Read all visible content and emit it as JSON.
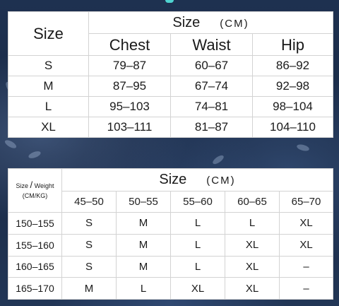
{
  "chest_table": {
    "size_header": "Size",
    "title": "Size",
    "unit": "(CM)",
    "columns": [
      "Chest",
      "Waist",
      "Hip"
    ],
    "rows": [
      {
        "size": "S",
        "chest": "79–87",
        "waist": "60–67",
        "hip": "86–92"
      },
      {
        "size": "M",
        "chest": "87–95",
        "waist": "67–74",
        "hip": "92–98"
      },
      {
        "size": "L",
        "chest": "95–103",
        "waist": "74–81",
        "hip": "98–104"
      },
      {
        "size": "XL",
        "chest": "103–111",
        "waist": "81–87",
        "hip": "104–110"
      }
    ]
  },
  "weight_table": {
    "corner_size": "Size",
    "corner_slash": "/",
    "corner_weight": "Weight",
    "corner_units": "(CM/KG)",
    "title": "Size",
    "unit": "(CM)",
    "weight_columns": [
      "45–50",
      "50–55",
      "55–60",
      "60–65",
      "65–70"
    ],
    "rows": [
      {
        "height": "150–155",
        "cells": [
          "S",
          "M",
          "L",
          "L",
          "XL"
        ]
      },
      {
        "height": "155–160",
        "cells": [
          "S",
          "M",
          "L",
          "XL",
          "XL"
        ]
      },
      {
        "height": "160–165",
        "cells": [
          "S",
          "M",
          "L",
          "XL",
          "–"
        ]
      },
      {
        "height": "165–170",
        "cells": [
          "M",
          "L",
          "XL",
          "XL",
          "–"
        ]
      }
    ]
  }
}
